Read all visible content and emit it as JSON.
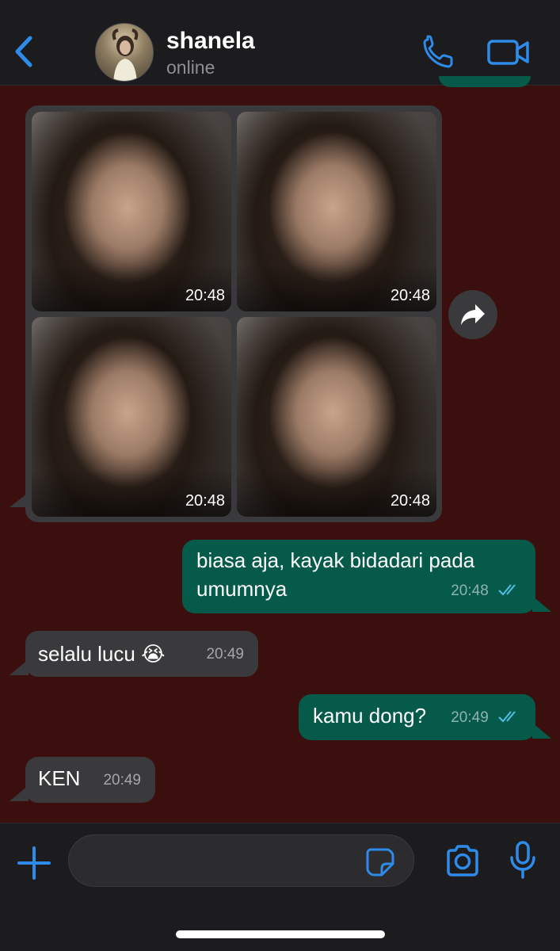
{
  "header": {
    "contact_name": "shanela",
    "status": "online",
    "icons": {
      "back": "chevron-left-icon",
      "call": "phone-icon",
      "video": "video-camera-icon"
    }
  },
  "colors": {
    "accent": "#2e8bea",
    "chat_background": "#3a0f0e",
    "outgoing_bubble": "#065a4a",
    "incoming_bubble": "#3a3a3c",
    "header_background": "#1c1c1e",
    "read_ticks": "#53bdeb"
  },
  "album": {
    "photos": [
      {
        "time": "20:48"
      },
      {
        "time": "20:48"
      },
      {
        "time": "20:48"
      },
      {
        "time": "20:48"
      }
    ],
    "forward_icon": "forward-arrow-icon"
  },
  "messages": [
    {
      "direction": "outgoing",
      "lines": [
        "biasa aja, kayak bidadari pada",
        "umumnya"
      ],
      "time": "20:48",
      "status": "read"
    },
    {
      "direction": "incoming",
      "text": "selalu lucu",
      "emoji": "😭",
      "time": "20:49"
    },
    {
      "direction": "outgoing",
      "text": "kamu dong?",
      "time": "20:49",
      "status": "read"
    },
    {
      "direction": "incoming",
      "text": "KEN",
      "time": "20:49"
    }
  ],
  "composer": {
    "placeholder": "",
    "value": "",
    "icons": {
      "attach": "plus-icon",
      "sticker": "sticker-icon",
      "camera": "camera-icon",
      "mic": "microphone-icon"
    }
  }
}
